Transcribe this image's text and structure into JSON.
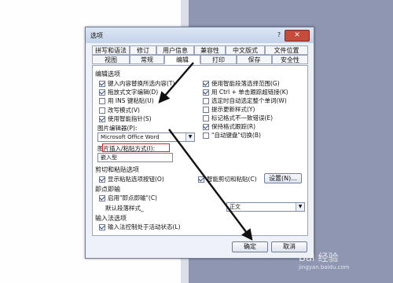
{
  "dialog": {
    "title": "选项",
    "help": "?",
    "close": "✕"
  },
  "tabs_row1": [
    "拼写和语法",
    "修订",
    "用户信息",
    "兼容性",
    "中文版式",
    "文件位置"
  ],
  "tabs_row2": [
    "视图",
    "常规",
    "编辑",
    "打印",
    "保存",
    "安全性"
  ],
  "active_tab": "编辑",
  "edit_options": {
    "header": "编辑选项",
    "left": [
      {
        "label": "键入内容替换所选内容(T)",
        "checked": true
      },
      {
        "label": "拖放式文字编辑(D)",
        "checked": true
      },
      {
        "label": "用 INS 键粘贴(U)",
        "checked": false
      },
      {
        "label": "改写模式(V)",
        "checked": false
      },
      {
        "label": "使用智能指针(S)",
        "checked": true
      }
    ],
    "right": [
      {
        "label": "使用智能段落选择范围(G)",
        "checked": true
      },
      {
        "label": "用 Ctrl + 单击跟踪超链接(K)",
        "checked": true
      },
      {
        "label": "选定时自动选定整个单词(W)",
        "checked": false
      },
      {
        "label": "提示更新样式(Y)",
        "checked": false
      },
      {
        "label": "标记格式不一致错误(E)",
        "checked": false
      },
      {
        "label": "保持格式跟踪(R)",
        "checked": true
      },
      {
        "label": "\"自动键盘\"切换(B)",
        "checked": false
      }
    ],
    "picture_editor_label": "图片编辑器(P):",
    "picture_editor_value": "Microsoft Office Word",
    "insert_paste_label": "图片插入/粘贴方式(I):",
    "insert_paste_value": "嵌入型"
  },
  "cut_paste": {
    "header": "剪切和粘贴选项",
    "show_paste_buttons": {
      "label": "显示粘贴选项按钮(O)",
      "checked": true
    },
    "smart_cut_paste": {
      "label": "智能剪切和粘贴(C)",
      "checked": true
    },
    "settings_button": "设置(N)..."
  },
  "click_and_type": {
    "header": "即点即输",
    "enable": {
      "label": "启用\"即点即输\"(C)",
      "checked": true
    },
    "default_style_label": "默认段落样式_",
    "default_style_value": "正文"
  },
  "ime": {
    "header": "输入法选项",
    "ime_control": {
      "label": "输入法控制处于活动状态(L)",
      "checked": true
    }
  },
  "buttons": {
    "ok": "确定",
    "cancel": "取消"
  },
  "watermark": {
    "text": "Bai 经验",
    "sub": "jingyan.baidu.com"
  }
}
